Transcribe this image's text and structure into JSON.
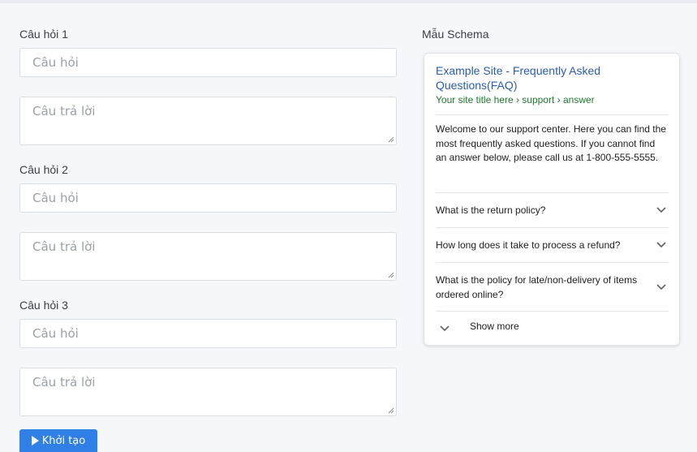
{
  "form": {
    "questions": [
      {
        "label": "Câu hỏi 1",
        "question_placeholder": "Câu hỏi",
        "answer_placeholder": "Câu trả lời"
      },
      {
        "label": "Câu hỏi 2",
        "question_placeholder": "Câu hỏi",
        "answer_placeholder": "Câu trả lời"
      },
      {
        "label": "Câu hỏi 3",
        "question_placeholder": "Câu hỏi",
        "answer_placeholder": "Câu trả lời"
      }
    ],
    "generate_label": "Khởi tạo"
  },
  "preview": {
    "heading": "Mẫu Schema",
    "site_title": "Example Site - Frequently Asked Questions(FAQ)",
    "site_url": "Your site title here › support › answer",
    "intro": "Welcome to our support center. Here you can find the most frequently asked questions. If you cannot find an answer below, please call us at 1-800-555-5555.",
    "faqs": [
      "What is the return policy?",
      "How long does it take to process a refund?",
      "What is the policy for late/non-delivery of items ordered online?"
    ],
    "show_more": "Show more"
  },
  "colors": {
    "background": "#f5f7fb",
    "button": "#2f7fe6",
    "link_blue": "#2a5db0",
    "url_green": "#1e7b2e"
  },
  "icons": [
    "play-icon",
    "chevron-down-icon",
    "resize-handle-icon"
  ]
}
